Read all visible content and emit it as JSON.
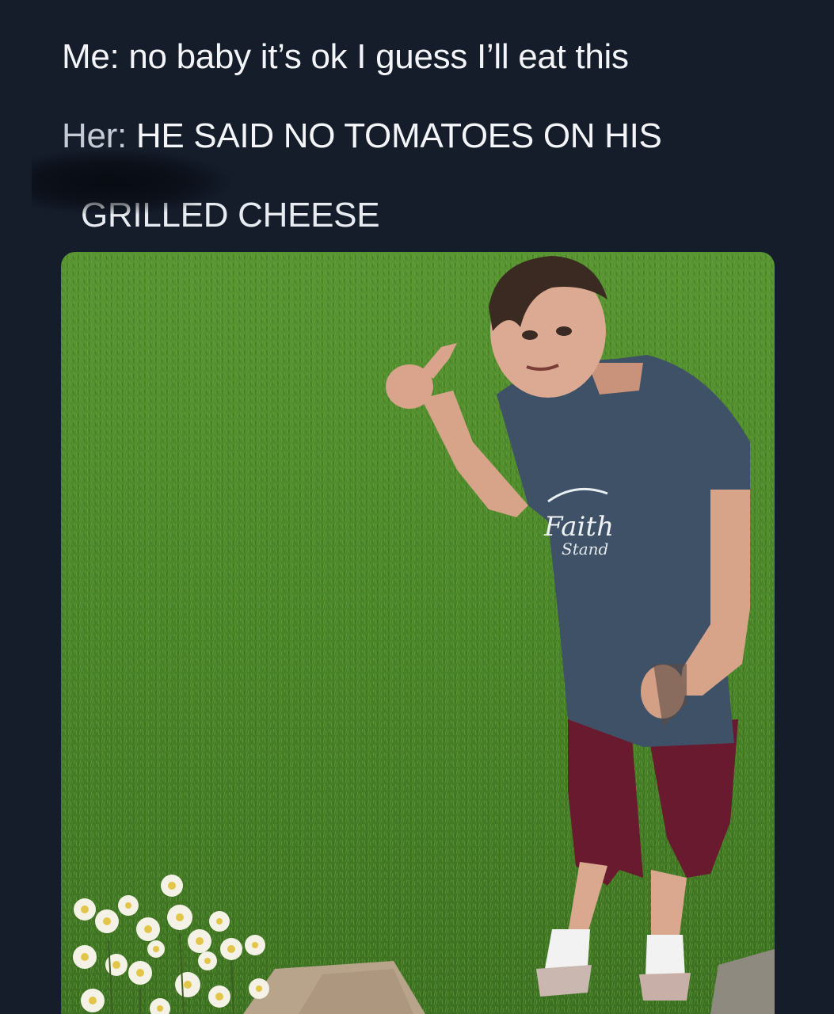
{
  "tweet": {
    "line1": "Me: no baby it’s ok I guess I’ll eat this",
    "line2_prefix": "Her:",
    "line2_rest": " HE SAID NO TOMATOES ON HIS",
    "line3": "GRILLED CHEESE"
  },
  "photo": {
    "shirt_text_line1": "Faith",
    "shirt_text_line2": "Stand"
  },
  "colors": {
    "background": "#151d2b",
    "text": "#f3f5f8",
    "grass": "#4f8a2c"
  }
}
